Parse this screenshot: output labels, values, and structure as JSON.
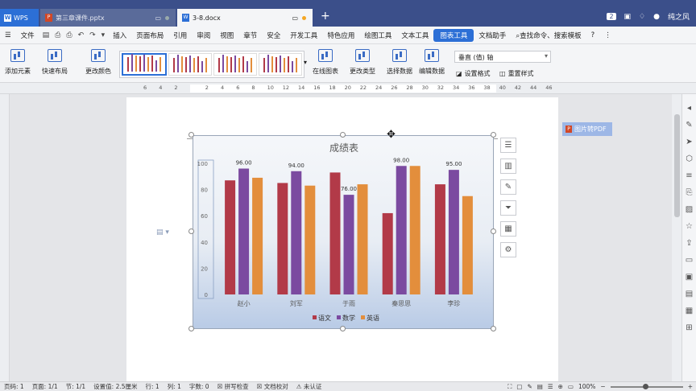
{
  "titlebar": {
    "app_label": "WPS",
    "tabs": [
      {
        "label": "第三章课件.pptx",
        "type": "P"
      },
      {
        "label": "3-8.docx",
        "type": "W"
      }
    ],
    "badge": "2",
    "user": "纯之风"
  },
  "menubar": {
    "file": "文件",
    "items": [
      "插入",
      "页面布局",
      "引用",
      "审阅",
      "视图",
      "章节",
      "安全",
      "开发工具",
      "特色应用",
      "绘图工具",
      "文本工具",
      "图表工具",
      "文档助手"
    ],
    "active": "图表工具",
    "search": "查找命令、搜索模板"
  },
  "ribbon": {
    "add_element": "添加元素",
    "quick_layout": "快速布局",
    "change_color": "更改颜色",
    "online_chart": "在线图表",
    "change_type": "更改类型",
    "select_data": "选择数据",
    "edit_data": "编辑数据",
    "axis_select": "垂直 (值) 轴",
    "set_format": "设置格式",
    "reset_style": "重置样式"
  },
  "ruler": {
    "numbers": [
      "6",
      "4",
      "2",
      "",
      "2",
      "4",
      "6",
      "8",
      "10",
      "12",
      "14",
      "16",
      "18",
      "20",
      "22",
      "24",
      "26",
      "28",
      "30",
      "32",
      "34",
      "36",
      "38",
      "40",
      "42",
      "44",
      "46"
    ]
  },
  "pdf_button": "图片转PDF",
  "chart_data": {
    "type": "bar",
    "title": "成绩表",
    "categories": [
      "赵小",
      "刘军",
      "于雨",
      "秦思思",
      "李珍"
    ],
    "series": [
      {
        "name": "语文",
        "color": "#b23a48",
        "values": [
          87,
          85,
          93,
          62,
          84
        ]
      },
      {
        "name": "数学",
        "color": "#7b4aa0",
        "values": [
          96,
          94,
          76,
          98,
          95
        ]
      },
      {
        "name": "英语",
        "color": "#e38e3c",
        "values": [
          89,
          83,
          84,
          98,
          75
        ]
      }
    ],
    "data_labels": [
      {
        "category": "赵小",
        "series": "数学",
        "text": "96.00"
      },
      {
        "category": "刘军",
        "series": "数学",
        "text": "94.00"
      },
      {
        "category": "于雨",
        "series": "数学",
        "text": "76.00"
      },
      {
        "category": "秦思思",
        "series": "数学",
        "text": "98.00"
      },
      {
        "category": "李珍",
        "series": "数学",
        "text": "95.00"
      }
    ],
    "yticks": [
      "0",
      "20",
      "40",
      "60",
      "80",
      "100"
    ],
    "ylim": [
      0,
      100
    ],
    "legend": "bottom",
    "grid": false
  },
  "status": {
    "page_no": "页码: 1",
    "pages": "页面: 1/1",
    "section": "节: 1/1",
    "setting": "设置值: 2.5厘米",
    "row": "行: 1",
    "col": "列: 1",
    "words": "字数: 0",
    "spell": "拼写检查",
    "proof": "文档校对",
    "cert": "未认证",
    "zoom": "100%"
  }
}
